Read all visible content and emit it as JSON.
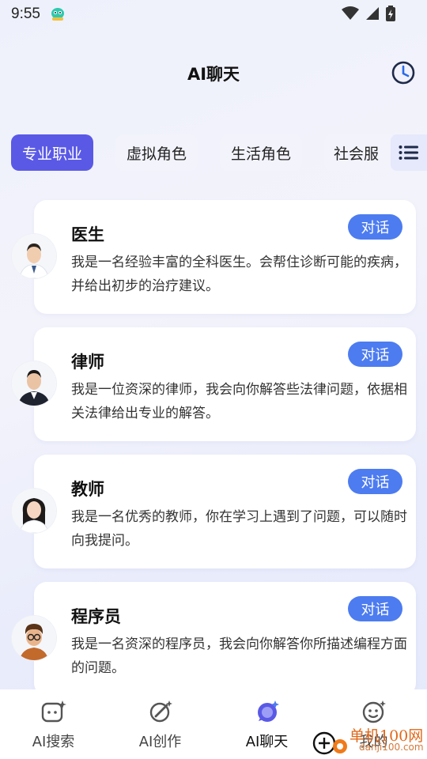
{
  "status_bar": {
    "time": "9:55"
  },
  "header": {
    "title": "AI聊天"
  },
  "tabs": [
    {
      "label": "专业职业",
      "active": true
    },
    {
      "label": "虚拟角色",
      "active": false
    },
    {
      "label": "生活角色",
      "active": false
    },
    {
      "label": "社会服",
      "active": false
    }
  ],
  "cards": [
    {
      "title": "医生",
      "description": "我是一名经验丰富的全科医生。会帮住诊断可能的疾病，并给出初步的治疗建议。",
      "button": "对话"
    },
    {
      "title": "律师",
      "description": "我是一位资深的律师，我会向你解答些法律问题，依据相关法律给出专业的解答。",
      "button": "对话"
    },
    {
      "title": "教师",
      "description": "我是一名优秀的教师，你在学习上遇到了问题，可以随时向我提问。",
      "button": "对话"
    },
    {
      "title": "程序员",
      "description": "我是一名资深的程序员，我会向你解答你所描述编程方面的问题。",
      "button": "对话"
    }
  ],
  "bottom_nav": [
    {
      "label": "AI搜索",
      "icon": "search-face-icon",
      "active": false
    },
    {
      "label": "AI创作",
      "icon": "pen-icon",
      "active": false
    },
    {
      "label": "AI聊天",
      "icon": "chat-icon",
      "active": true
    },
    {
      "label": "我的",
      "icon": "smiley-icon",
      "active": false
    }
  ],
  "watermark": {
    "text": "单机100网",
    "url": "danji100.com"
  },
  "colors": {
    "accent": "#5a59e6",
    "button": "#4d7cf0"
  }
}
